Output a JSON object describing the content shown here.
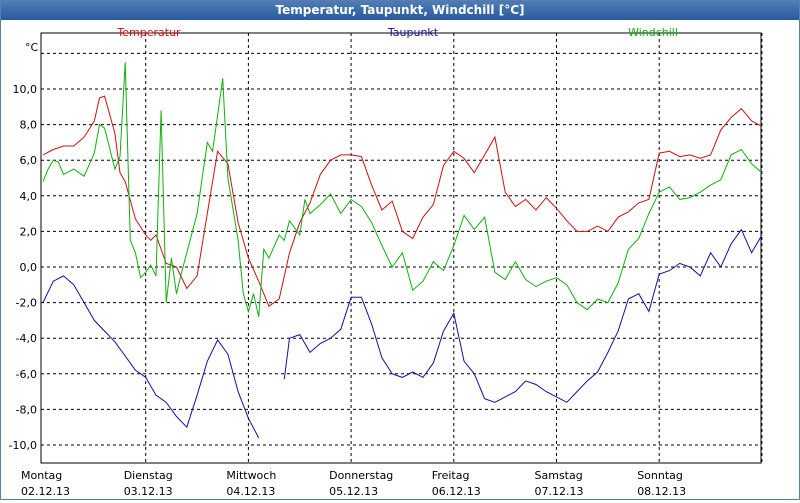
{
  "window": {
    "title": "Temperatur, Taupunkt, Windchill [°C]"
  },
  "chart_data": {
    "type": "line",
    "title": "Temperatur, Taupunkt, Windchill [°C]",
    "ylabel": "°C",
    "ylim": [
      -11,
      12
    ],
    "yticks": [
      10,
      8,
      6,
      4,
      2,
      0,
      -2,
      -4,
      -6,
      -8,
      -10
    ],
    "ytick_labels": [
      "10,0",
      "8,0",
      "6,0",
      "4,0",
      "2,0",
      "0,0",
      "-2,0",
      "-4,0",
      "-6,0",
      "-8,0",
      "-10,0"
    ],
    "xlim": [
      0,
      7
    ],
    "xticks": [
      0,
      1,
      2,
      3,
      4,
      5,
      6
    ],
    "xtick_labels": [
      {
        "day": "Montag",
        "date": "02.12.13"
      },
      {
        "day": "Dienstag",
        "date": "03.12.13"
      },
      {
        "day": "Mittwoch",
        "date": "04.12.13"
      },
      {
        "day": "Donnerstag",
        "date": "05.12.13"
      },
      {
        "day": "Freitag",
        "date": "06.12.13"
      },
      {
        "day": "Samstag",
        "date": "07.12.13"
      },
      {
        "day": "Sonntag",
        "date": "08.12.13"
      }
    ],
    "grid": true,
    "legend": "top",
    "series": [
      {
        "name": "Temperatur",
        "color": "#d01010",
        "x": [
          0,
          0.1,
          0.2,
          0.3,
          0.4,
          0.5,
          0.55,
          0.6,
          0.7,
          0.75,
          0.8,
          0.9,
          1.0,
          1.05,
          1.1,
          1.2,
          1.3,
          1.4,
          1.5,
          1.6,
          1.7,
          1.8,
          1.9,
          2.0,
          2.1,
          2.2,
          2.3,
          2.4,
          2.5,
          2.6,
          2.7,
          2.8,
          2.9,
          3.0,
          3.1,
          3.2,
          3.3,
          3.4,
          3.5,
          3.6,
          3.7,
          3.8,
          3.9,
          4.0,
          4.1,
          4.2,
          4.3,
          4.4,
          4.5,
          4.6,
          4.7,
          4.8,
          4.9,
          5.0,
          5.1,
          5.2,
          5.3,
          5.4,
          5.5,
          5.6,
          5.7,
          5.8,
          5.9,
          6.0,
          6.1,
          6.2,
          6.3,
          6.4,
          6.5,
          6.6,
          6.7,
          6.8,
          6.9,
          7.0
        ],
        "values": [
          6.3,
          6.6,
          6.8,
          6.8,
          7.3,
          8.2,
          9.5,
          9.6,
          7.5,
          5.3,
          4.8,
          2.7,
          1.8,
          1.5,
          1.8,
          0.2,
          0.0,
          -1.2,
          -0.5,
          3.0,
          6.5,
          5.8,
          2.5,
          0.5,
          -0.8,
          -2.2,
          -1.8,
          0.8,
          2.5,
          3.6,
          5.2,
          6.0,
          6.3,
          6.3,
          6.2,
          4.6,
          3.2,
          3.7,
          2.0,
          1.6,
          2.8,
          3.5,
          5.7,
          6.5,
          6.1,
          5.3,
          6.3,
          7.3,
          4.2,
          3.4,
          3.8,
          3.2,
          3.9,
          3.3,
          2.6,
          2.0,
          2.0,
          2.3,
          2.0,
          2.8,
          3.1,
          3.6,
          3.8,
          6.4,
          6.5,
          6.2,
          6.3,
          6.1,
          6.3,
          7.7,
          8.4,
          8.9,
          8.2,
          7.9
        ]
      },
      {
        "name": "Taupunkt",
        "color": "#1010a0",
        "segments": [
          {
            "x": [
              0,
              0.1,
              0.2,
              0.3,
              0.4,
              0.5,
              0.6,
              0.7,
              0.8,
              0.9,
              1.0,
              1.1,
              1.2,
              1.3,
              1.4,
              1.5,
              1.6,
              1.7,
              1.8,
              1.9,
              2.0,
              2.1
            ],
            "values": [
              -2.0,
              -0.8,
              -0.5,
              -1.0,
              -2.0,
              -3.0,
              -3.6,
              -4.2,
              -5.0,
              -5.8,
              -6.2,
              -7.2,
              -7.6,
              -8.4,
              -9.0,
              -7.2,
              -5.3,
              -4.1,
              -4.9,
              -7.0,
              -8.5,
              -9.6
            ]
          },
          {
            "x": [
              2.35,
              2.4,
              2.5,
              2.6,
              2.7,
              2.8,
              2.9,
              3.0,
              3.1,
              3.2,
              3.3,
              3.4,
              3.5,
              3.6,
              3.7,
              3.8,
              3.9,
              4.0,
              4.1,
              4.2,
              4.3,
              4.4,
              4.5,
              4.6,
              4.7,
              4.8,
              4.9,
              5.0,
              5.1,
              5.2,
              5.3,
              5.4,
              5.5,
              5.6,
              5.7,
              5.8,
              5.9,
              6.0,
              6.1,
              6.2,
              6.3,
              6.4,
              6.5,
              6.6,
              6.7,
              6.8,
              6.9,
              7.0
            ],
            "values": [
              -6.3,
              -4.0,
              -3.8,
              -4.8,
              -4.3,
              -4.0,
              -3.5,
              -1.7,
              -1.7,
              -3.2,
              -5.1,
              -6.0,
              -6.2,
              -5.9,
              -6.2,
              -5.4,
              -3.6,
              -2.6,
              -5.3,
              -6.0,
              -7.4,
              -7.6,
              -7.3,
              -7.0,
              -6.4,
              -6.6,
              -7.0,
              -7.3,
              -7.6,
              -7.0,
              -6.4,
              -5.9,
              -4.8,
              -3.6,
              -1.8,
              -1.5,
              -2.5,
              -0.4,
              -0.2,
              0.2,
              0.0,
              -0.5,
              0.8,
              0.0,
              1.3,
              2.1,
              0.8,
              1.8
            ]
          }
        ]
      },
      {
        "name": "Windchill",
        "color": "#10b010",
        "x": [
          0,
          0.05,
          0.1,
          0.15,
          0.2,
          0.3,
          0.4,
          0.5,
          0.55,
          0.6,
          0.7,
          0.75,
          0.8,
          0.85,
          0.9,
          0.95,
          1.0,
          1.05,
          1.1,
          1.15,
          1.2,
          1.25,
          1.3,
          1.35,
          1.4,
          1.5,
          1.6,
          1.65,
          1.7,
          1.75,
          1.8,
          1.9,
          1.95,
          2.0,
          2.05,
          2.1,
          2.15,
          2.2,
          2.3,
          2.35,
          2.4,
          2.5,
          2.55,
          2.6,
          2.7,
          2.8,
          2.9,
          3.0,
          3.1,
          3.2,
          3.3,
          3.4,
          3.5,
          3.6,
          3.7,
          3.8,
          3.9,
          4.0,
          4.1,
          4.2,
          4.3,
          4.4,
          4.5,
          4.6,
          4.7,
          4.8,
          4.9,
          5.0,
          5.1,
          5.2,
          5.3,
          5.4,
          5.5,
          5.6,
          5.7,
          5.8,
          5.9,
          6.0,
          6.1,
          6.2,
          6.3,
          6.4,
          6.5,
          6.6,
          6.7,
          6.8,
          6.9,
          7.0
        ],
        "values": [
          4.8,
          5.5,
          6.0,
          5.9,
          5.2,
          5.5,
          5.1,
          6.4,
          8.0,
          7.8,
          5.5,
          6.2,
          11.5,
          1.5,
          0.8,
          -0.6,
          -0.3,
          0.1,
          -0.5,
          8.8,
          -2.0,
          0.5,
          -1.5,
          -0.3,
          0.8,
          3.0,
          7.0,
          6.5,
          8.5,
          10.6,
          5.0,
          1.5,
          -1.5,
          -2.5,
          -1.5,
          -2.8,
          1.0,
          0.5,
          1.8,
          1.5,
          2.6,
          1.8,
          3.8,
          3.0,
          3.5,
          4.1,
          3.0,
          3.8,
          3.4,
          2.5,
          1.2,
          0.0,
          0.8,
          -1.3,
          -0.8,
          0.3,
          -0.2,
          1.2,
          2.9,
          2.1,
          2.8,
          -0.3,
          -0.7,
          0.3,
          -0.7,
          -1.1,
          -0.8,
          -0.6,
          -1.0,
          -2.0,
          -2.4,
          -1.8,
          -2.0,
          -0.9,
          1.0,
          1.6,
          3.0,
          4.2,
          4.5,
          3.8,
          3.9,
          4.2,
          4.6,
          4.9,
          6.3,
          6.6,
          5.8,
          5.3
        ]
      }
    ]
  }
}
